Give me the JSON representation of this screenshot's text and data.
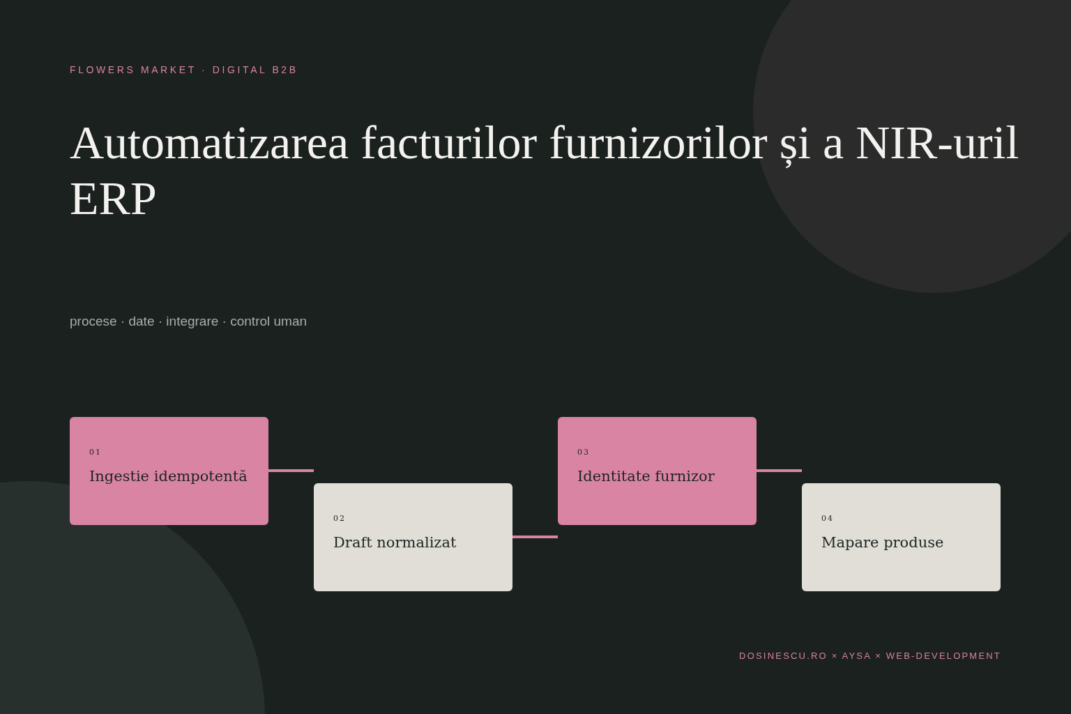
{
  "eyebrow": "FLOWERS MARKET · DIGITAL B2B",
  "title_lines": [
    "Automatizarea facturilor furnizorilor și a NIR-uril",
    "ERP"
  ],
  "subtitle": "procese · date · integrare · control uman",
  "steps": [
    {
      "number": "01",
      "label": "Ingestie idempotentă",
      "kind": "accent"
    },
    {
      "number": "02",
      "label": "Draft normalizat",
      "kind": "plain"
    },
    {
      "number": "03",
      "label": "Identitate furnizor",
      "kind": "accent"
    },
    {
      "number": "04",
      "label": "Mapare produse",
      "kind": "plain"
    }
  ],
  "footer": "DOSINESCU.RO × AYSA × WEB-DEVELOPMENT"
}
